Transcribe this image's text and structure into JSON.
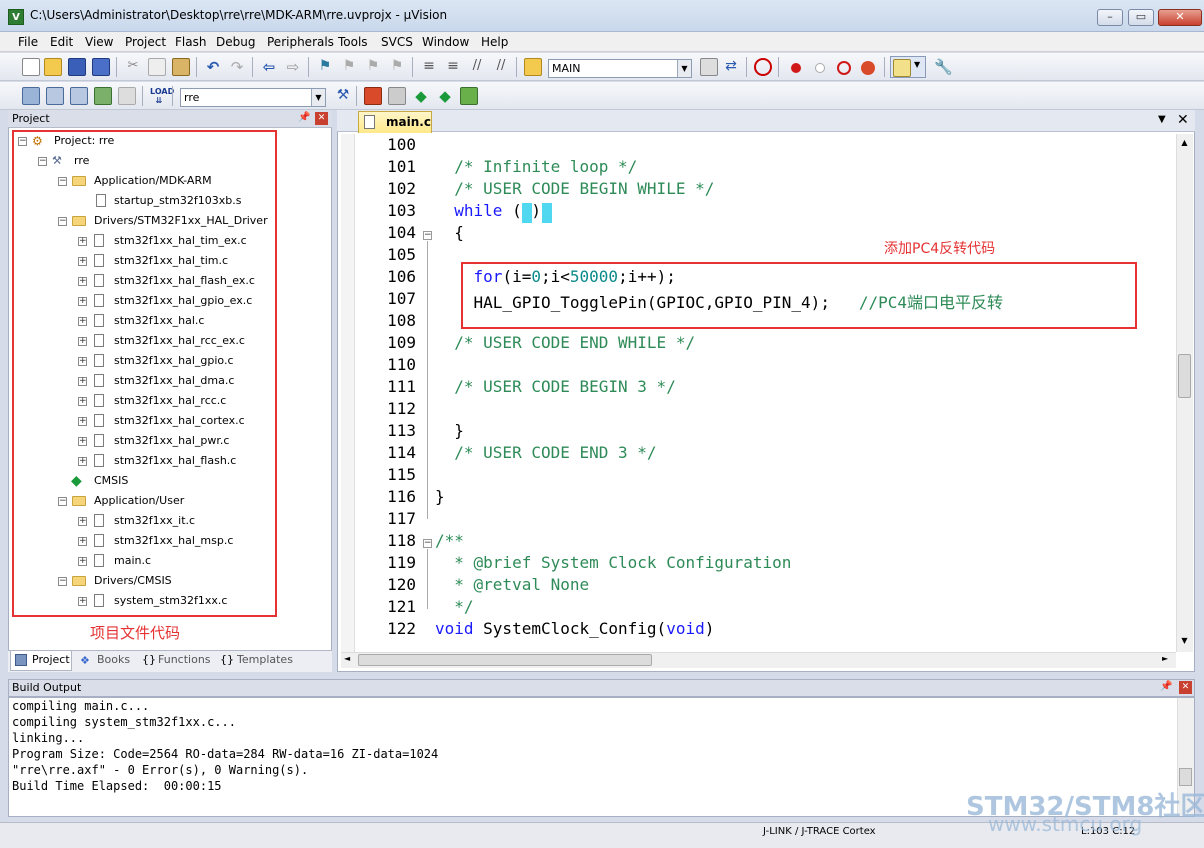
{
  "window": {
    "title": "C:\\Users\\Administrator\\Desktop\\rre\\rre\\MDK-ARM\\rre.uvprojx - µVision",
    "icon_letter": "V"
  },
  "menu": [
    "File",
    "Edit",
    "View",
    "Project",
    "Flash",
    "Debug",
    "Peripherals",
    "Tools",
    "SVCS",
    "Window",
    "Help"
  ],
  "toolbar": {
    "function_combo": "MAIN",
    "target_combo": "rre"
  },
  "project_panel": {
    "title": "Project",
    "root": "Project: rre",
    "target": "rre",
    "groups": [
      {
        "name": "Application/MDK-ARM",
        "files": [
          "startup_stm32f103xb.s"
        ]
      },
      {
        "name": "Drivers/STM32F1xx_HAL_Driver",
        "files": [
          "stm32f1xx_hal_tim_ex.c",
          "stm32f1xx_hal_tim.c",
          "stm32f1xx_hal_flash_ex.c",
          "stm32f1xx_hal_gpio_ex.c",
          "stm32f1xx_hal.c",
          "stm32f1xx_hal_rcc_ex.c",
          "stm32f1xx_hal_gpio.c",
          "stm32f1xx_hal_dma.c",
          "stm32f1xx_hal_rcc.c",
          "stm32f1xx_hal_cortex.c",
          "stm32f1xx_hal_pwr.c",
          "stm32f1xx_hal_flash.c"
        ]
      },
      {
        "name": "CMSIS",
        "files": []
      },
      {
        "name": "Application/User",
        "files": [
          "stm32f1xx_it.c",
          "stm32f1xx_hal_msp.c",
          "main.c"
        ]
      },
      {
        "name": "Drivers/CMSIS",
        "files": [
          "system_stm32f1xx.c"
        ]
      }
    ],
    "annotation": "项目文件代码",
    "tabs": [
      "Project",
      "Books",
      "Functions",
      "Templates"
    ]
  },
  "editor": {
    "tab": "main.c",
    "annotation": "添加PC4反转代码",
    "lines": [
      {
        "n": "100",
        "t": ""
      },
      {
        "n": "101",
        "t": "  /* Infinite loop */"
      },
      {
        "n": "102",
        "t": "  /* USER CODE BEGIN WHILE */"
      },
      {
        "n": "103",
        "t": "  while (1)"
      },
      {
        "n": "104",
        "t": "  {"
      },
      {
        "n": "105",
        "t": ""
      },
      {
        "n": "106",
        "t": "    for(i=0;i<50000;i++);"
      },
      {
        "n": "107",
        "t": "    HAL_GPIO_TogglePin(GPIOC,GPIO_PIN_4);   //PC4端口电平反转"
      },
      {
        "n": "108",
        "t": ""
      },
      {
        "n": "109",
        "t": "  /* USER CODE END WHILE */"
      },
      {
        "n": "110",
        "t": ""
      },
      {
        "n": "111",
        "t": "  /* USER CODE BEGIN 3 */"
      },
      {
        "n": "112",
        "t": ""
      },
      {
        "n": "113",
        "t": "  }"
      },
      {
        "n": "114",
        "t": "  /* USER CODE END 3 */"
      },
      {
        "n": "115",
        "t": ""
      },
      {
        "n": "116",
        "t": "}"
      },
      {
        "n": "117",
        "t": ""
      },
      {
        "n": "118",
        "t": "/**"
      },
      {
        "n": "119",
        "t": "  * @brief System Clock Configuration"
      },
      {
        "n": "120",
        "t": "  * @retval None"
      },
      {
        "n": "121",
        "t": "  */"
      },
      {
        "n": "122",
        "t": "void SystemClock_Config(void)"
      }
    ]
  },
  "build_output": {
    "title": "Build Output",
    "lines": [
      "compiling main.c...",
      "compiling system_stm32f1xx.c...",
      "linking...",
      "Program Size: Code=2564 RO-data=284 RW-data=16 ZI-data=1024",
      "\"rre\\rre.axf\" - 0 Error(s), 0 Warning(s).",
      "Build Time Elapsed:  00:00:15"
    ]
  },
  "status": {
    "debugger": "J-LINK / J-TRACE Cortex",
    "position": "L:103 C:12"
  },
  "watermark": {
    "line1": "STM32/STM8社区",
    "line2": "www.stmcu.org"
  },
  "colors": {
    "annotation_red": "#e53333",
    "comment_green": "#2e8b57",
    "keyword_blue": "#1a1aff"
  }
}
